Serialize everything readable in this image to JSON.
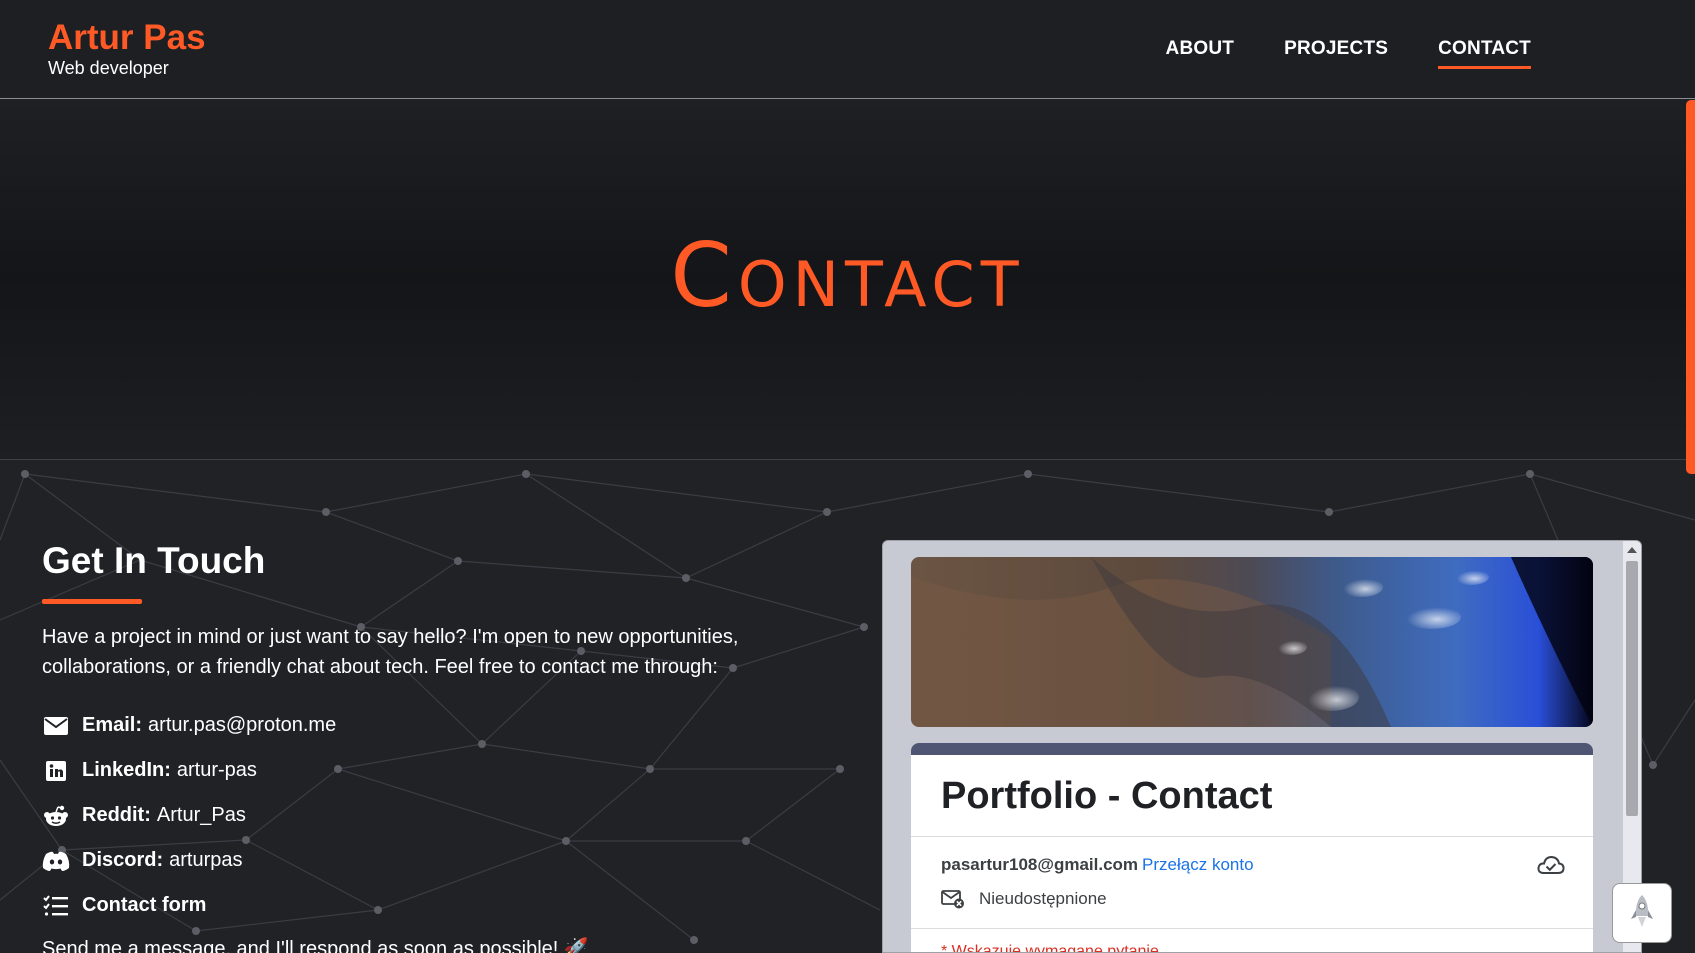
{
  "header": {
    "brand_name": "Artur Pas",
    "brand_subtitle": "Web developer",
    "nav": [
      {
        "label": "ABOUT",
        "active": false
      },
      {
        "label": "PROJECTS",
        "active": false
      },
      {
        "label": "CONTACT",
        "active": true
      }
    ]
  },
  "hero": {
    "title": "Contact"
  },
  "contact": {
    "heading": "Get In Touch",
    "intro": "Have a project in mind or just want to say hello? I'm open to new opportunities, collaborations, or a friendly chat about tech. Feel free to contact me through:",
    "items": [
      {
        "icon": "envelope-icon",
        "label": "Email:",
        "value": "artur.pas@proton.me"
      },
      {
        "icon": "linkedin-icon",
        "label": "LinkedIn:",
        "value": "artur-pas"
      },
      {
        "icon": "reddit-icon",
        "label": "Reddit:",
        "value": "Artur_Pas"
      },
      {
        "icon": "discord-icon",
        "label": "Discord:",
        "value": "arturpas"
      },
      {
        "icon": "checklist-icon",
        "label": "Contact form",
        "value": ""
      }
    ],
    "footnote": "Send me a message, and I'll respond as soon as possible! 🚀"
  },
  "form": {
    "title": "Portfolio - Contact",
    "account_email": "pasartur108@gmail.com",
    "switch_account": "Przełącz konto",
    "not_shared": "Nieudostępnione",
    "required_note": "* Wskazuje wymagane pytanie"
  },
  "colors": {
    "accent": "#ff5a26",
    "background": "#202226",
    "form_header": "#4f5674",
    "link": "#1a73e8"
  }
}
